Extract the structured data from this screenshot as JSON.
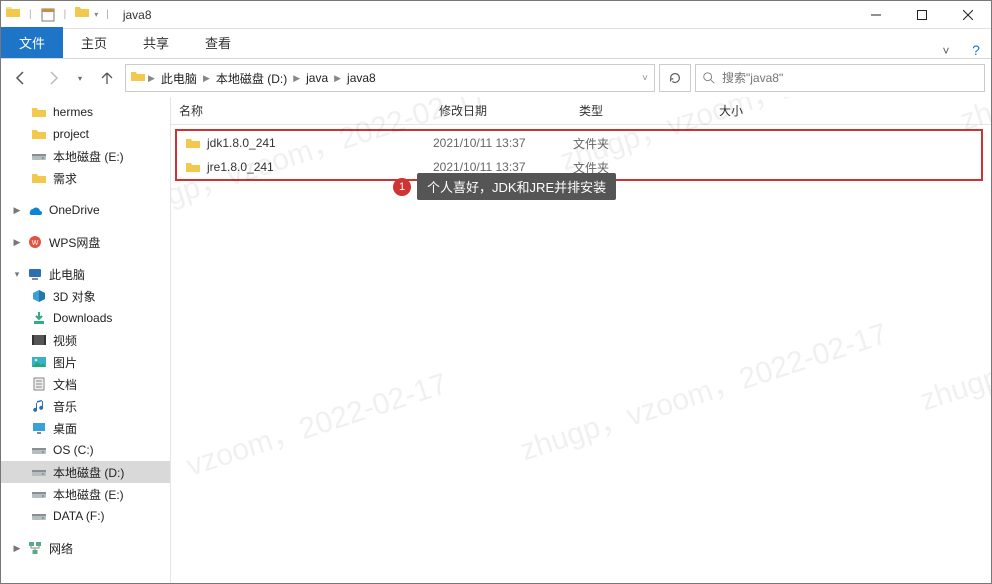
{
  "title": "java8",
  "qat_check": "☑",
  "ribbon": {
    "file": "文件",
    "home": "主页",
    "share": "共享",
    "view": "查看"
  },
  "nav": {
    "crumbs": [
      "此电脑",
      "本地磁盘 (D:)",
      "java",
      "java8"
    ],
    "search_placeholder": "搜索\"java8\""
  },
  "columns": {
    "name": "名称",
    "date": "修改日期",
    "type": "类型",
    "size": "大小"
  },
  "files": [
    {
      "name": "jdk1.8.0_241",
      "date": "2021/10/11 13:37",
      "type": "文件夹",
      "size": ""
    },
    {
      "name": "jre1.8.0_241",
      "date": "2021/10/11 13:37",
      "type": "文件夹",
      "size": ""
    }
  ],
  "callout": {
    "num": "1",
    "text": "个人喜好，JDK和JRE并排安装"
  },
  "tree": {
    "quick": [
      {
        "label": "hermes",
        "icon": "folder"
      },
      {
        "label": "project",
        "icon": "folder"
      },
      {
        "label": "本地磁盘 (E:)",
        "icon": "drive"
      },
      {
        "label": "需求",
        "icon": "folder"
      }
    ],
    "onedrive": "OneDrive",
    "wps": "WPS网盘",
    "pc": "此电脑",
    "pc_children": [
      {
        "label": "3D 对象",
        "icon": "3d"
      },
      {
        "label": "Downloads",
        "icon": "dl"
      },
      {
        "label": "视频",
        "icon": "vid"
      },
      {
        "label": "图片",
        "icon": "pic"
      },
      {
        "label": "文档",
        "icon": "doc"
      },
      {
        "label": "音乐",
        "icon": "mus"
      },
      {
        "label": "桌面",
        "icon": "desk"
      },
      {
        "label": "OS (C:)",
        "icon": "drive"
      },
      {
        "label": "本地磁盘 (D:)",
        "icon": "drive",
        "selected": true
      },
      {
        "label": "本地磁盘 (E:)",
        "icon": "drive"
      },
      {
        "label": "DATA (F:)",
        "icon": "drive"
      }
    ],
    "net": "网络"
  },
  "watermark": "zhugp，vzoom，2022-02-17"
}
